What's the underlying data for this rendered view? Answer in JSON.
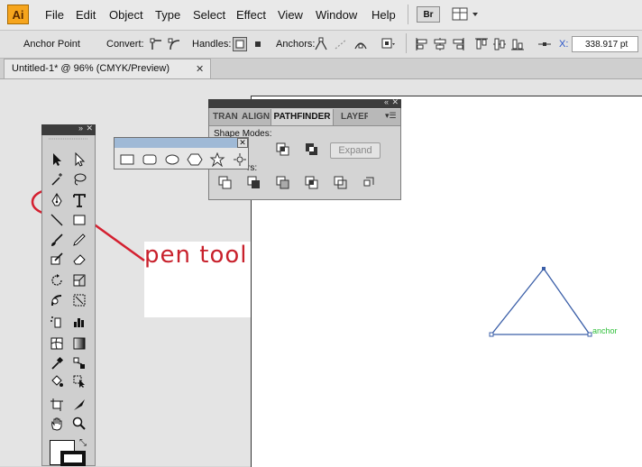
{
  "app": {
    "logo_text": "Ai",
    "bridge_label": "Br"
  },
  "menu": [
    "File",
    "Edit",
    "Object",
    "Type",
    "Select",
    "Effect",
    "View",
    "Window",
    "Help"
  ],
  "control_bar": {
    "tool_name": "Anchor Point",
    "convert_label": "Convert:",
    "handles_label": "Handles:",
    "anchors_label": "Anchors:",
    "x_label": "X:",
    "x_value": "338.917 pt"
  },
  "document": {
    "tab_title": "Untitled-1* @ 96% (CMYK/Preview)"
  },
  "pathfinder": {
    "tabs": [
      "TRAN",
      "ALIGN",
      "PATHFINDER",
      "LAYER"
    ],
    "shape_modes_label": "Shape Modes:",
    "pathfinders_label": "rs:",
    "expand_label": "Expand"
  },
  "annotation": {
    "text": "pen tool",
    "color": "#c8212c"
  },
  "canvas": {
    "anchor_label": "anchor",
    "triangle_color": "#3b5fa8"
  },
  "icons": {
    "tools": [
      "selection-icon",
      "direct-selection-icon",
      "magic-wand-icon",
      "lasso-icon",
      "pen-icon",
      "type-icon",
      "line-segment-icon",
      "rectangle-icon",
      "paintbrush-icon",
      "pencil-icon",
      "blob-brush-icon",
      "eraser-icon",
      "rotate-icon",
      "scale-icon",
      "warp-icon",
      "free-transform-icon",
      "symbol-sprayer-icon",
      "column-graph-icon",
      "mesh-icon",
      "gradient-icon",
      "eyedropper-icon",
      "blend-icon",
      "live-paint-icon",
      "live-paint-select-icon",
      "artboard-icon",
      "slice-icon",
      "hand-icon",
      "zoom-icon"
    ],
    "flyout": [
      "rectangle-shape-icon",
      "rounded-rectangle-icon",
      "ellipse-icon",
      "polygon-icon",
      "star-icon",
      "flare-icon"
    ]
  }
}
